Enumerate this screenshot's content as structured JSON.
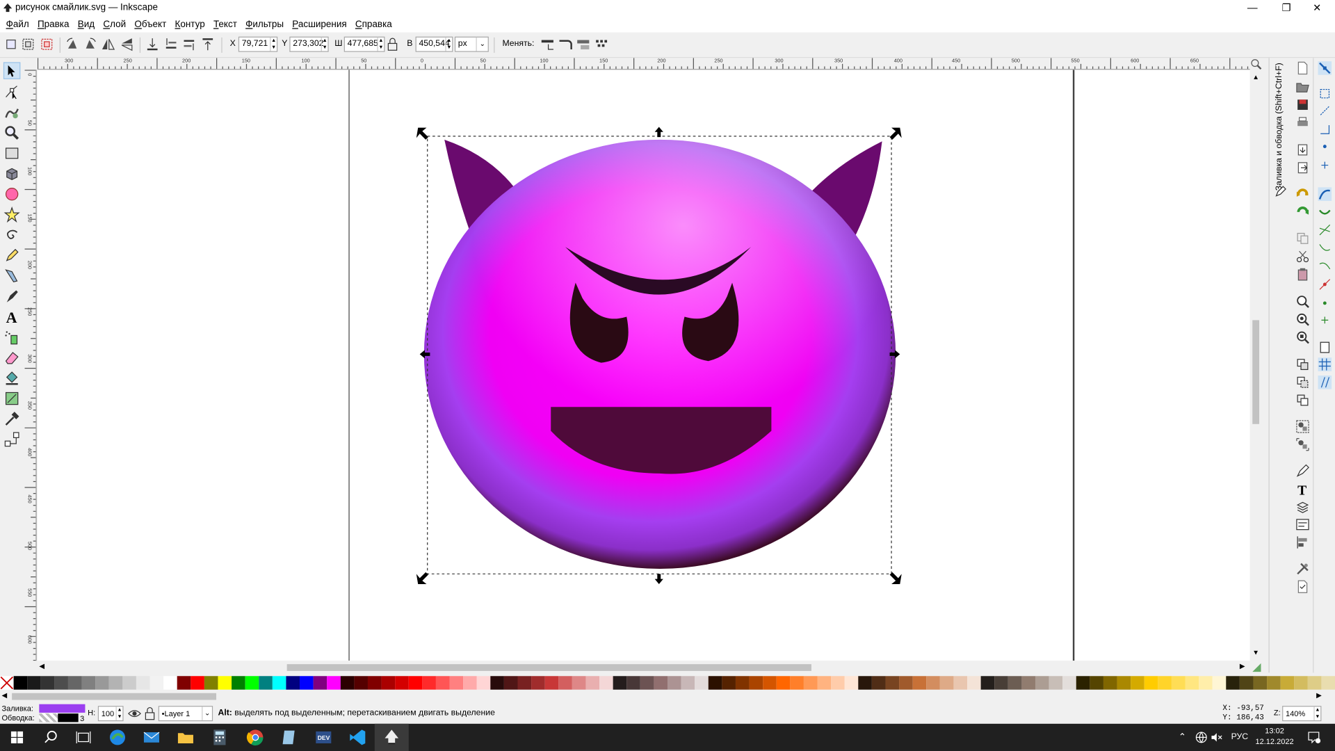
{
  "window": {
    "title": "рисунок смайлик.svg — Inkscape",
    "minimize_glyph": "—",
    "maximize_glyph": "❐",
    "close_glyph": "✕"
  },
  "menu": [
    "Файл",
    "Правка",
    "Вид",
    "Слой",
    "Объект",
    "Контур",
    "Текст",
    "Фильтры",
    "Расширения",
    "Справка"
  ],
  "toolbar": {
    "x_label": "X",
    "x_value": "79,721",
    "y_label": "Y",
    "y_value": "273,302",
    "w_label": "Ш",
    "w_value": "477,685",
    "h_label": "В",
    "h_value": "450,544",
    "unit": "px",
    "transform_label": "Менять:"
  },
  "rulers": {
    "h_labels": [
      "300",
      "250",
      "200",
      "150",
      "100",
      "50",
      "0",
      "50",
      "100",
      "150",
      "200",
      "250",
      "300",
      "350",
      "400",
      "450",
      "500",
      "550",
      "600",
      "650"
    ],
    "v_labels": [
      "0",
      "50",
      "100",
      "150",
      "200",
      "250",
      "300",
      "350",
      "400",
      "450",
      "500",
      "550",
      "600"
    ]
  },
  "dock": {
    "panel_title": "Заливка и обводка (Shift+Ctrl+F)"
  },
  "status": {
    "fill_label": "Заливка:",
    "stroke_label": "Обводка:",
    "fill_color": "#9b3ff0",
    "stroke_color": "#000000",
    "stroke_width": "3",
    "opacity_label": "Н:",
    "opacity_value": "100",
    "layer": "•Layer 1",
    "message_bold": "Alt:",
    "message": " выделять под выделенным; перетаскиванием двигать выделение",
    "cursor_x_label": "X:",
    "cursor_x": "-93,57",
    "cursor_y_label": "Y:",
    "cursor_y": "186,43",
    "zoom_label": "Z:",
    "zoom_value": "140%"
  },
  "taskbar": {
    "lang": "РУС",
    "time": "13:02",
    "date": "12.12.2022"
  },
  "palette": [
    "#000000",
    "#1a1a1a",
    "#333333",
    "#4d4d4d",
    "#666666",
    "#808080",
    "#999999",
    "#b3b3b3",
    "#cccccc",
    "#e6e6e6",
    "#f2f2f2",
    "#ffffff",
    "#800000",
    "#ff0000",
    "#808000",
    "#ffff00",
    "#008000",
    "#00ff00",
    "#008080",
    "#00ffff",
    "#000080",
    "#0000ff",
    "#800080",
    "#ff00ff",
    "#2b0000",
    "#550000",
    "#800000",
    "#aa0000",
    "#d40000",
    "#ff0000",
    "#ff2a2a",
    "#ff5555",
    "#ff8080",
    "#ffaaaa",
    "#ffd5d5",
    "#280b0b",
    "#501616",
    "#782121",
    "#a02c2c",
    "#c83737",
    "#d35f5f",
    "#de8787",
    "#e9afaf",
    "#f4d7d7",
    "#241c1c",
    "#483737",
    "#6c5353",
    "#916f6f",
    "#ac9393",
    "#c8b7b7",
    "#e3dbdb",
    "#2b1100",
    "#552200",
    "#803300",
    "#aa4400",
    "#d45500",
    "#ff6600",
    "#ff7f2a",
    "#ff9955",
    "#ffb380",
    "#ffccaa",
    "#ffe6d5",
    "#28170b",
    "#502d16",
    "#784421",
    "#a05a2c",
    "#c87137",
    "#d38d5f",
    "#deaa87",
    "#e9c6af",
    "#f4e3d7",
    "#241f1c",
    "#483e37",
    "#6c5d53",
    "#917c6f",
    "#ac9d93",
    "#c8beb7",
    "#e3dedb",
    "#2b2200",
    "#554400",
    "#806600",
    "#aa8800",
    "#d4aa00",
    "#ffcc00",
    "#ffd42a",
    "#ffdd55",
    "#ffe680",
    "#ffeeaa",
    "#fff6d5",
    "#28220b",
    "#504416",
    "#786721",
    "#a0892c",
    "#c8ab37",
    "#d3bc5f",
    "#decd87",
    "#e9ddaf"
  ]
}
